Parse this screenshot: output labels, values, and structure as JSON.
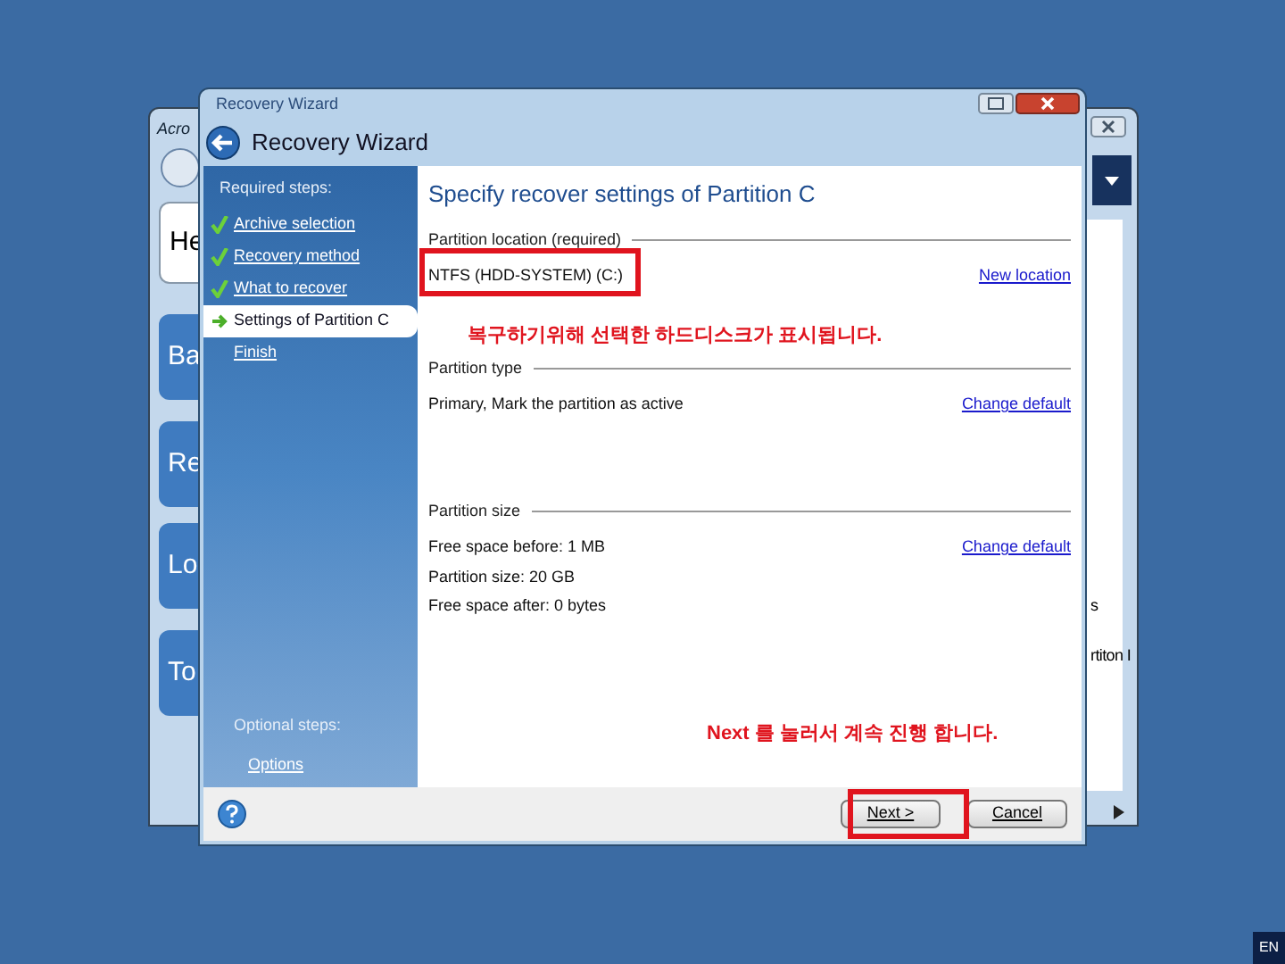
{
  "back_window": {
    "title": "Acro",
    "tiles": [
      "He",
      "Ba",
      "Re",
      "Lo",
      "To"
    ],
    "right_texts": [
      "s",
      "rtiton I"
    ]
  },
  "window": {
    "title": "Recovery Wizard",
    "header": "Recovery Wizard"
  },
  "sidebar": {
    "required_heading": "Required steps:",
    "steps": [
      {
        "label": "Archive selection",
        "kind": "done",
        "selected": false
      },
      {
        "label": "Recovery method",
        "kind": "done",
        "selected": false
      },
      {
        "label": "What to recover",
        "kind": "done",
        "selected": false
      },
      {
        "label": "Settings of Partition C",
        "kind": "current",
        "selected": true
      },
      {
        "label": "Finish",
        "kind": "todo",
        "selected": false
      }
    ],
    "optional_heading": "Optional steps:",
    "optional_steps": [
      {
        "label": "Options"
      }
    ]
  },
  "content": {
    "title": "Specify recover settings of Partition C",
    "sections": [
      {
        "heading": "Partition location (required)",
        "lines": [
          "NTFS (HDD-SYSTEM) (C:)"
        ],
        "link": "New location"
      },
      {
        "heading": "Partition type",
        "lines": [
          "Primary, Mark the partition as active"
        ],
        "link": "Change default"
      },
      {
        "heading": "Partition size",
        "lines": [
          "Free space before: 1 MB",
          "Partition size: 20 GB",
          "Free space after: 0 bytes"
        ],
        "link": "Change default"
      }
    ]
  },
  "annotations": [
    {
      "text": "복구하기위해 선택한 하드디스크가 표시됩니다."
    },
    {
      "text": "Next 를 눌러서 계속 진행 합니다."
    }
  ],
  "buttons": [
    {
      "label": "Next >"
    },
    {
      "label": "Cancel"
    }
  ],
  "language": "EN"
}
